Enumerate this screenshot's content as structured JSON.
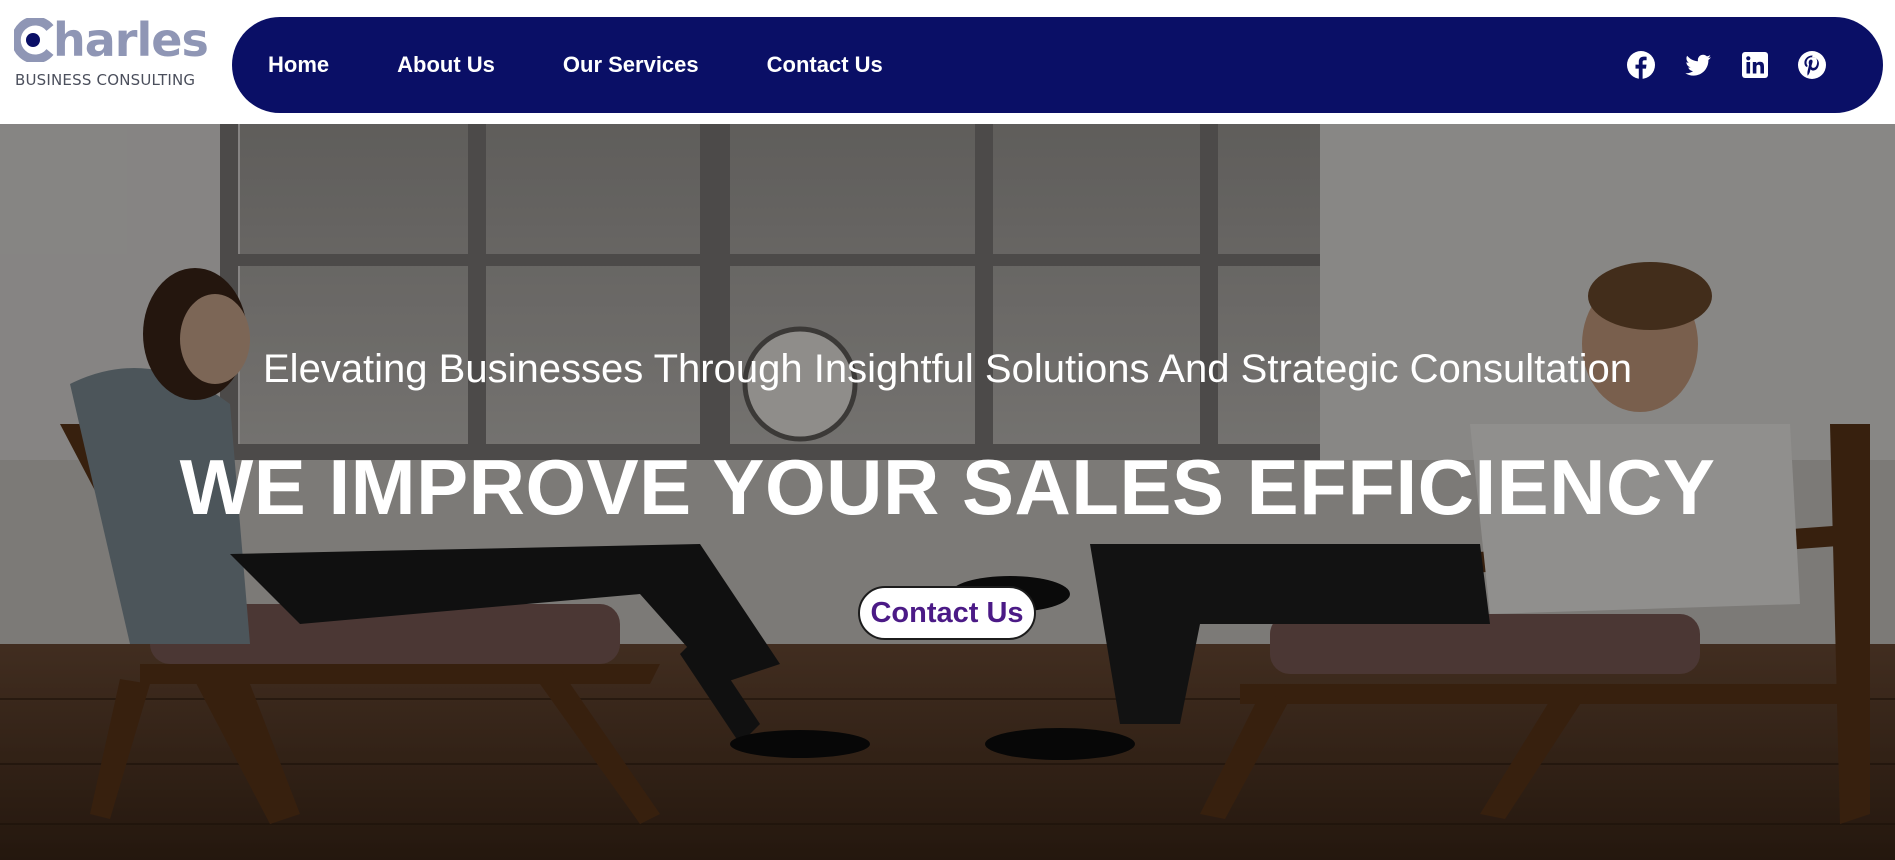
{
  "brand": {
    "logo_text": "Charles",
    "logo_rest": "harles",
    "tagline": "BUSINESS CONSULTING",
    "logo_color": "#8f96b5"
  },
  "nav": {
    "background": "#0a0f66",
    "items": [
      {
        "label": "Home"
      },
      {
        "label": "About Us"
      },
      {
        "label": "Our Services"
      },
      {
        "label": "Contact Us"
      }
    ],
    "socials": [
      {
        "icon": "facebook-icon"
      },
      {
        "icon": "twitter-icon"
      },
      {
        "icon": "linkedin-icon"
      },
      {
        "icon": "pinterest-icon"
      }
    ]
  },
  "hero": {
    "subtitle": "Elevating Businesses Through Insightful Solutions And Strategic Consultation",
    "title": "WE IMPROVE YOUR SALES EFFICIENCY",
    "cta_label": "Contact Us",
    "cta_color": "#4b1a86"
  }
}
